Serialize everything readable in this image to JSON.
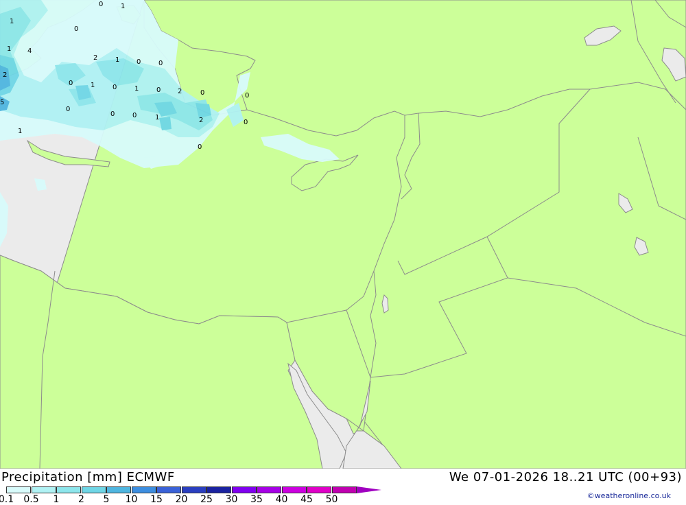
{
  "footer": {
    "title": "Precipitation [mm] ECMWF",
    "datetime": "We 07-01-2026 18..21 UTC (00+93)",
    "credit": "©weatheronline.co.uk"
  },
  "legend": {
    "ticks": [
      "0.1",
      "0.5",
      "1",
      "2",
      "5",
      "10",
      "15",
      "20",
      "25",
      "30",
      "35",
      "40",
      "45",
      "50"
    ],
    "colors": [
      "#d8fbfb",
      "#b0f2f4",
      "#8de6ec",
      "#6fd6e6",
      "#4fb6e0",
      "#3d8ee0",
      "#3a62d8",
      "#2a3fc0",
      "#1a22a0",
      "#8000f0",
      "#a600e6",
      "#cc00e0",
      "#e000c8",
      "#c000b0"
    ],
    "arrow_color": "#a000c0"
  },
  "map": {
    "sea_color": "#ebebeb",
    "land_color": "#ccff99",
    "border_color": "#8c8c8c",
    "precip_labels": [
      "0",
      "1",
      "1",
      "0",
      "1",
      "4",
      "2",
      "1",
      "0",
      "0",
      "2",
      "0",
      "1",
      "0",
      "1",
      "0",
      "2",
      "0",
      "0",
      "5",
      "0",
      "0",
      "0",
      "1",
      "2",
      "0",
      "1",
      "0"
    ]
  }
}
